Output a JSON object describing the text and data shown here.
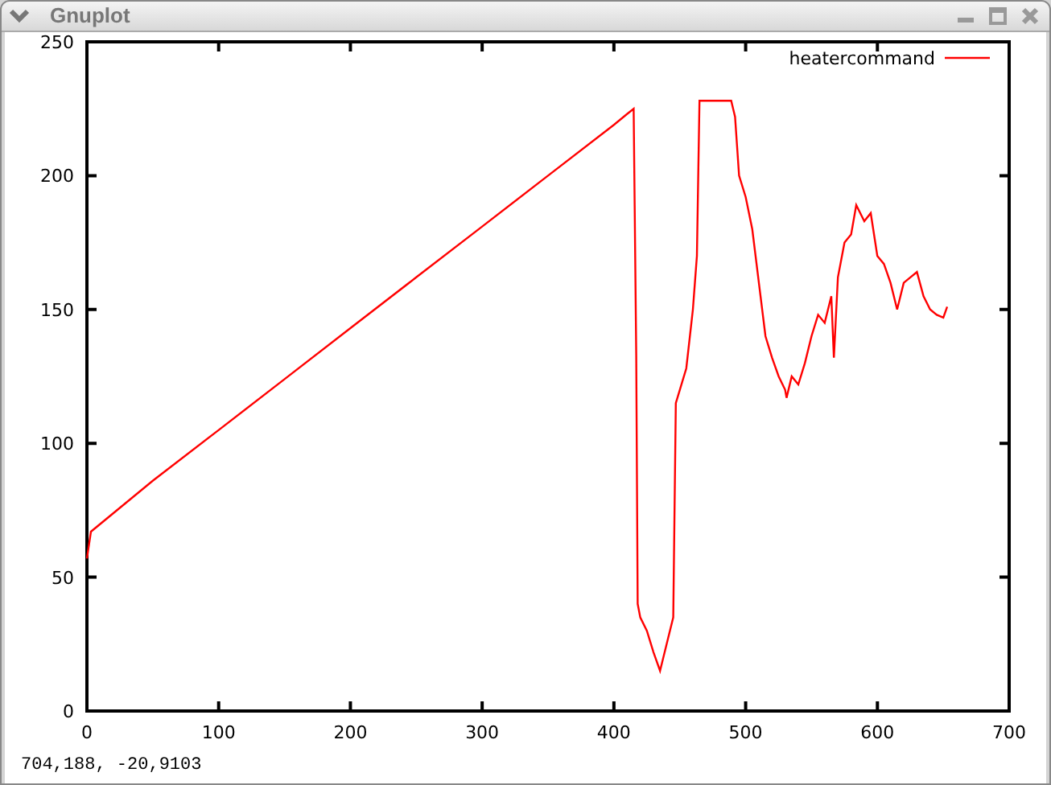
{
  "window": {
    "title": "Gnuplot"
  },
  "chart_data": {
    "type": "line",
    "x": [
      0,
      3,
      50,
      100,
      150,
      200,
      250,
      300,
      350,
      400,
      410,
      415,
      417,
      418,
      420,
      425,
      430,
      435,
      440,
      445,
      447,
      450,
      455,
      460,
      463,
      465,
      489,
      492,
      495,
      500,
      505,
      510,
      515,
      520,
      525,
      530,
      531,
      535,
      540,
      545,
      550,
      555,
      560,
      565,
      567,
      570,
      575,
      580,
      584,
      590,
      595,
      600,
      605,
      610,
      615,
      620,
      625,
      630,
      635,
      640,
      645,
      650,
      653
    ],
    "series": [
      {
        "name": "heatercommand",
        "color": "#ff0000",
        "values": [
          57,
          67,
          86,
          105,
          124,
          143,
          162,
          181,
          200,
          219,
          223,
          225,
          133,
          40,
          35,
          30,
          22,
          15,
          25,
          35,
          115,
          120,
          128,
          150,
          170,
          228,
          228,
          222,
          200,
          192,
          180,
          160,
          140,
          132,
          125,
          120,
          117,
          125,
          122,
          130,
          140,
          148,
          145,
          155,
          132,
          162,
          175,
          178,
          189,
          183,
          186,
          170,
          167,
          160,
          150,
          160,
          162,
          164,
          155,
          150,
          148,
          147,
          151
        ]
      }
    ],
    "xlim": [
      0,
      700
    ],
    "ylim": [
      0,
      250
    ],
    "xticks": [
      0,
      100,
      200,
      300,
      400,
      500,
      600,
      700
    ],
    "yticks": [
      0,
      50,
      100,
      150,
      200,
      250
    ]
  },
  "status_bar": "704,188, -20,9103"
}
